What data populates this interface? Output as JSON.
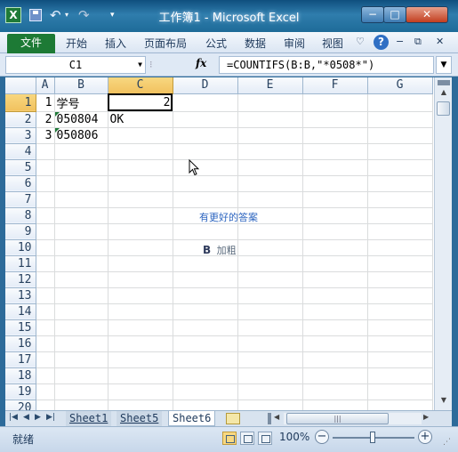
{
  "window": {
    "title": "工作簿1 - Microsoft Excel",
    "logo_letter": "X",
    "minimize": "−",
    "maximize": "□",
    "close": "✕"
  },
  "quick_access": {
    "undo": "↶",
    "redo": "↷",
    "customize": "▾"
  },
  "ribbon": {
    "file_tab": "文件",
    "tabs": [
      "开始",
      "插入",
      "页面布局",
      "公式",
      "数据",
      "审阅",
      "视图"
    ],
    "help": "?",
    "collapse": "♡",
    "minimize": "−",
    "restore": "⧉",
    "close": "✕"
  },
  "formula_bar": {
    "name_box": "C1",
    "fx": "fx",
    "formula": "=COUNTIFS(B:B,\"*0508*\")"
  },
  "grid": {
    "columns": [
      "A",
      "B",
      "C",
      "D",
      "E",
      "F",
      "G"
    ],
    "rows": [
      "1",
      "2",
      "3",
      "4",
      "5",
      "6",
      "7",
      "8",
      "9",
      "10",
      "11",
      "12",
      "13",
      "14",
      "15",
      "16",
      "17",
      "18",
      "19",
      "20"
    ],
    "cells": {
      "A1": "1",
      "B1": "学号",
      "C1": "2",
      "A2": "2",
      "B2": "050804",
      "C2": "OK",
      "A3": "3",
      "B3": "050806"
    },
    "active_cell": "C1"
  },
  "sheet_tabs": {
    "tabs": [
      "Sheet1",
      "Sheet5",
      "Sheet6"
    ],
    "active": "Sheet6"
  },
  "status_bar": {
    "status": "就绪",
    "zoom": "100%",
    "zoom_fraction": 0.5
  },
  "overlay": {
    "line1": "有更好的答案",
    "logo": "B",
    "line2": "加粗"
  }
}
